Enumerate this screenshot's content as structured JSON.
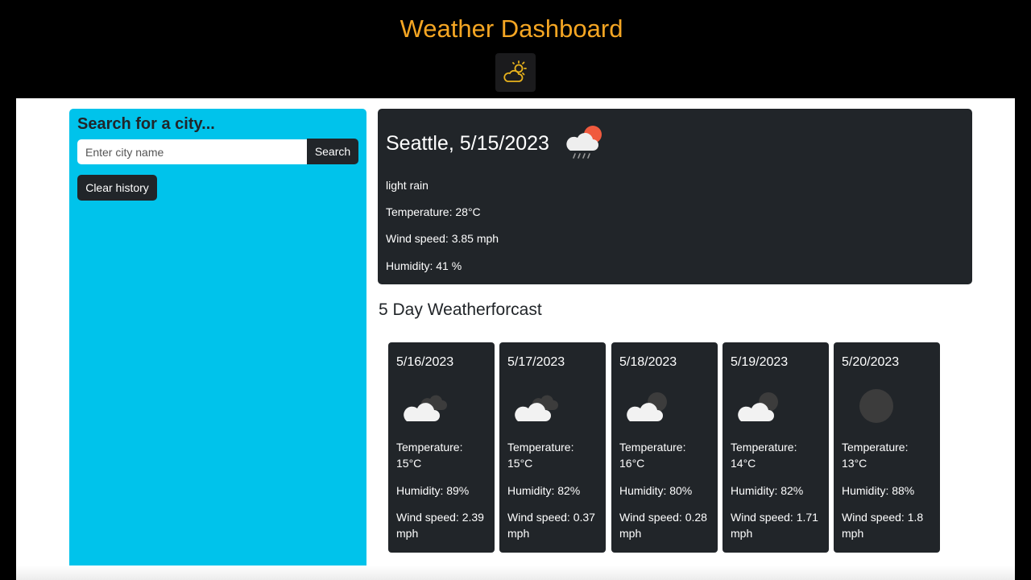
{
  "header": {
    "title": "Weather Dashboard",
    "logo_icon": "cloud-sun-icon"
  },
  "search": {
    "heading": "Search for a city...",
    "placeholder": "Enter city name",
    "value": "",
    "button_label": "Search",
    "clear_label": "Clear history"
  },
  "current": {
    "title": "Seattle, 5/15/2023",
    "icon": "light-rain-icon",
    "description": "light rain",
    "temperature": "Temperature: 28°C",
    "wind": "Wind speed: 3.85 mph",
    "humidity": "Humidity: 41 %"
  },
  "forecast": {
    "title": "5 Day Weatherforcast",
    "days": [
      {
        "date": "5/16/2023",
        "icon": "broken-clouds-icon",
        "temperature": "Temperature: 15°C",
        "humidity": "Humidity: 89%",
        "wind": "Wind speed: 2.39 mph"
      },
      {
        "date": "5/17/2023",
        "icon": "broken-clouds-icon",
        "temperature": "Temperature: 15°C",
        "humidity": "Humidity: 82%",
        "wind": "Wind speed: 0.37 mph"
      },
      {
        "date": "5/18/2023",
        "icon": "scattered-clouds-icon",
        "temperature": "Temperature: 16°C",
        "humidity": "Humidity: 80%",
        "wind": "Wind speed: 0.28 mph"
      },
      {
        "date": "5/19/2023",
        "icon": "scattered-clouds-icon",
        "temperature": "Temperature: 14°C",
        "humidity": "Humidity: 82%",
        "wind": "Wind speed: 1.71 mph"
      },
      {
        "date": "5/20/2023",
        "icon": "clear-night-icon",
        "temperature": "Temperature: 13°C",
        "humidity": "Humidity: 88%",
        "wind": "Wind speed: 1.8 mph"
      }
    ]
  },
  "colors": {
    "title": "#f5a623",
    "sidebar": "#00c3eb",
    "card": "#212529",
    "sun": "#f05a3e"
  }
}
